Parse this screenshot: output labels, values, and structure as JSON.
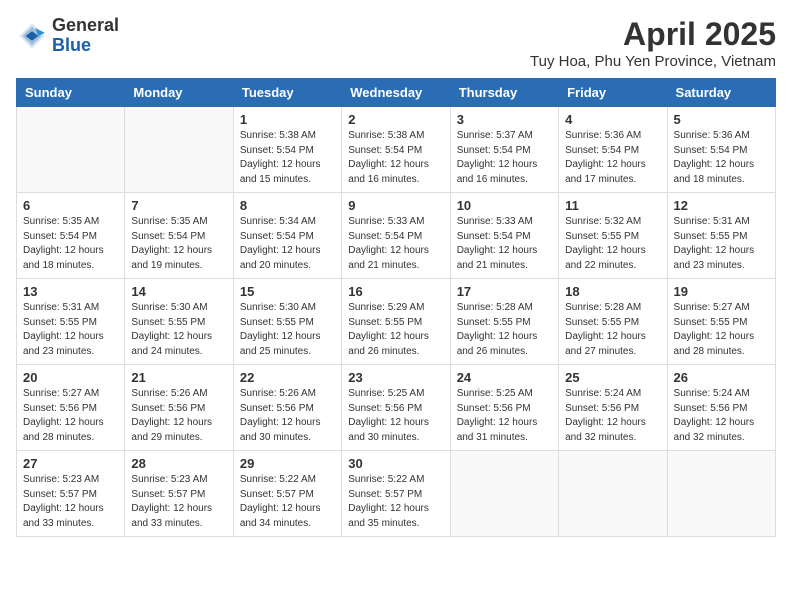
{
  "header": {
    "logo_general": "General",
    "logo_blue": "Blue",
    "month_year": "April 2025",
    "location": "Tuy Hoa, Phu Yen Province, Vietnam"
  },
  "days_of_week": [
    "Sunday",
    "Monday",
    "Tuesday",
    "Wednesday",
    "Thursday",
    "Friday",
    "Saturday"
  ],
  "weeks": [
    [
      {
        "day": "",
        "info": ""
      },
      {
        "day": "",
        "info": ""
      },
      {
        "day": "1",
        "info": "Sunrise: 5:38 AM\nSunset: 5:54 PM\nDaylight: 12 hours and 15 minutes."
      },
      {
        "day": "2",
        "info": "Sunrise: 5:38 AM\nSunset: 5:54 PM\nDaylight: 12 hours and 16 minutes."
      },
      {
        "day": "3",
        "info": "Sunrise: 5:37 AM\nSunset: 5:54 PM\nDaylight: 12 hours and 16 minutes."
      },
      {
        "day": "4",
        "info": "Sunrise: 5:36 AM\nSunset: 5:54 PM\nDaylight: 12 hours and 17 minutes."
      },
      {
        "day": "5",
        "info": "Sunrise: 5:36 AM\nSunset: 5:54 PM\nDaylight: 12 hours and 18 minutes."
      }
    ],
    [
      {
        "day": "6",
        "info": "Sunrise: 5:35 AM\nSunset: 5:54 PM\nDaylight: 12 hours and 18 minutes."
      },
      {
        "day": "7",
        "info": "Sunrise: 5:35 AM\nSunset: 5:54 PM\nDaylight: 12 hours and 19 minutes."
      },
      {
        "day": "8",
        "info": "Sunrise: 5:34 AM\nSunset: 5:54 PM\nDaylight: 12 hours and 20 minutes."
      },
      {
        "day": "9",
        "info": "Sunrise: 5:33 AM\nSunset: 5:54 PM\nDaylight: 12 hours and 21 minutes."
      },
      {
        "day": "10",
        "info": "Sunrise: 5:33 AM\nSunset: 5:54 PM\nDaylight: 12 hours and 21 minutes."
      },
      {
        "day": "11",
        "info": "Sunrise: 5:32 AM\nSunset: 5:55 PM\nDaylight: 12 hours and 22 minutes."
      },
      {
        "day": "12",
        "info": "Sunrise: 5:31 AM\nSunset: 5:55 PM\nDaylight: 12 hours and 23 minutes."
      }
    ],
    [
      {
        "day": "13",
        "info": "Sunrise: 5:31 AM\nSunset: 5:55 PM\nDaylight: 12 hours and 23 minutes."
      },
      {
        "day": "14",
        "info": "Sunrise: 5:30 AM\nSunset: 5:55 PM\nDaylight: 12 hours and 24 minutes."
      },
      {
        "day": "15",
        "info": "Sunrise: 5:30 AM\nSunset: 5:55 PM\nDaylight: 12 hours and 25 minutes."
      },
      {
        "day": "16",
        "info": "Sunrise: 5:29 AM\nSunset: 5:55 PM\nDaylight: 12 hours and 26 minutes."
      },
      {
        "day": "17",
        "info": "Sunrise: 5:28 AM\nSunset: 5:55 PM\nDaylight: 12 hours and 26 minutes."
      },
      {
        "day": "18",
        "info": "Sunrise: 5:28 AM\nSunset: 5:55 PM\nDaylight: 12 hours and 27 minutes."
      },
      {
        "day": "19",
        "info": "Sunrise: 5:27 AM\nSunset: 5:55 PM\nDaylight: 12 hours and 28 minutes."
      }
    ],
    [
      {
        "day": "20",
        "info": "Sunrise: 5:27 AM\nSunset: 5:56 PM\nDaylight: 12 hours and 28 minutes."
      },
      {
        "day": "21",
        "info": "Sunrise: 5:26 AM\nSunset: 5:56 PM\nDaylight: 12 hours and 29 minutes."
      },
      {
        "day": "22",
        "info": "Sunrise: 5:26 AM\nSunset: 5:56 PM\nDaylight: 12 hours and 30 minutes."
      },
      {
        "day": "23",
        "info": "Sunrise: 5:25 AM\nSunset: 5:56 PM\nDaylight: 12 hours and 30 minutes."
      },
      {
        "day": "24",
        "info": "Sunrise: 5:25 AM\nSunset: 5:56 PM\nDaylight: 12 hours and 31 minutes."
      },
      {
        "day": "25",
        "info": "Sunrise: 5:24 AM\nSunset: 5:56 PM\nDaylight: 12 hours and 32 minutes."
      },
      {
        "day": "26",
        "info": "Sunrise: 5:24 AM\nSunset: 5:56 PM\nDaylight: 12 hours and 32 minutes."
      }
    ],
    [
      {
        "day": "27",
        "info": "Sunrise: 5:23 AM\nSunset: 5:57 PM\nDaylight: 12 hours and 33 minutes."
      },
      {
        "day": "28",
        "info": "Sunrise: 5:23 AM\nSunset: 5:57 PM\nDaylight: 12 hours and 33 minutes."
      },
      {
        "day": "29",
        "info": "Sunrise: 5:22 AM\nSunset: 5:57 PM\nDaylight: 12 hours and 34 minutes."
      },
      {
        "day": "30",
        "info": "Sunrise: 5:22 AM\nSunset: 5:57 PM\nDaylight: 12 hours and 35 minutes."
      },
      {
        "day": "",
        "info": ""
      },
      {
        "day": "",
        "info": ""
      },
      {
        "day": "",
        "info": ""
      }
    ]
  ]
}
